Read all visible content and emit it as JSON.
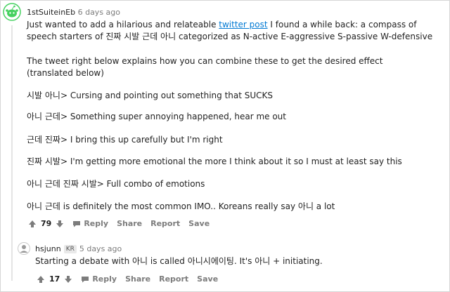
{
  "comment1": {
    "username": "1stSuiteinEb",
    "time": "6 days ago",
    "text_before_link": "Just wanted to add a hilarious and relateable ",
    "link_text": "twitter post",
    "text_after_link": " I found a while back: a compass of speech starters of 진짜 시발 근데 아니 categorized as N-active E-aggressive S-passive W-defensive",
    "paragraph2": "The tweet right below explains how you can combine these to get the desired effect (translated below)",
    "lines": [
      "시발 아니> Cursing and pointing out something that SUCKS",
      "아니 근데> Something super annoying happened, hear me out",
      "근데 진짜> I bring this up carefully but I'm right",
      "진짜 시발> I'm getting more emotional the more I think about it so I must at least say this",
      "아니 근데 진짜 시발> Full combo of emotions",
      "아니 근데 is definitely the most common IMO.. Koreans really say 아니 a lot"
    ],
    "score": "79",
    "actions": {
      "reply": "Reply",
      "share": "Share",
      "report": "Report",
      "save": "Save"
    }
  },
  "comment2": {
    "username": "hsjunn",
    "flair": "KR",
    "time": "5 days ago",
    "text": "Starting a debate with 아니 is called 아니시에이팅. It's 아니 + initiating.",
    "score": "17",
    "actions": {
      "reply": "Reply",
      "share": "Share",
      "report": "Report",
      "save": "Save"
    }
  },
  "colors": {
    "link": "#0079d3",
    "muted": "#7c7c7c",
    "text": "#1c1c1c",
    "avatar_green": "#46d160"
  }
}
